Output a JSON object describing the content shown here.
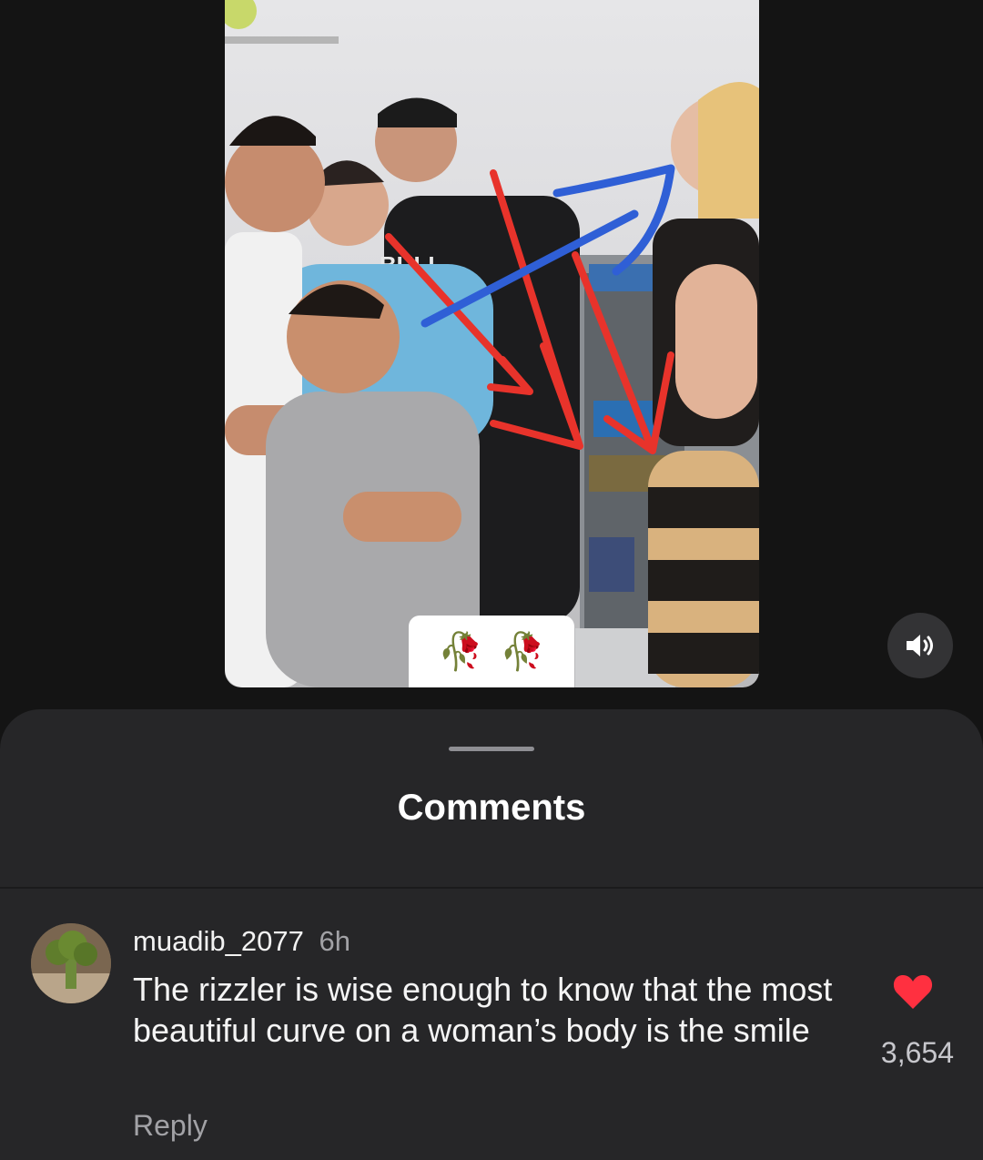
{
  "video": {
    "shirt_text": "BULL",
    "sticker": {
      "emoji": [
        "🥀",
        "🥀"
      ]
    },
    "sound_icon": "speaker-on-icon"
  },
  "comments_sheet": {
    "title": "Comments",
    "comment": {
      "avatar_icon": "broccoli-avatar",
      "username": "muadib_2077",
      "time": "6h",
      "text": "The rizzler is wise enough to know that the most beautiful curve on a woman’s body is the smile",
      "like_icon": "heart-icon",
      "like_count": "3,654",
      "reply_label": "Reply"
    }
  },
  "colors": {
    "background": "#141414",
    "sheet": "#262628",
    "heart": "#ff3040",
    "annotation_red": "#e8332b",
    "annotation_blue": "#2f5fd6"
  }
}
